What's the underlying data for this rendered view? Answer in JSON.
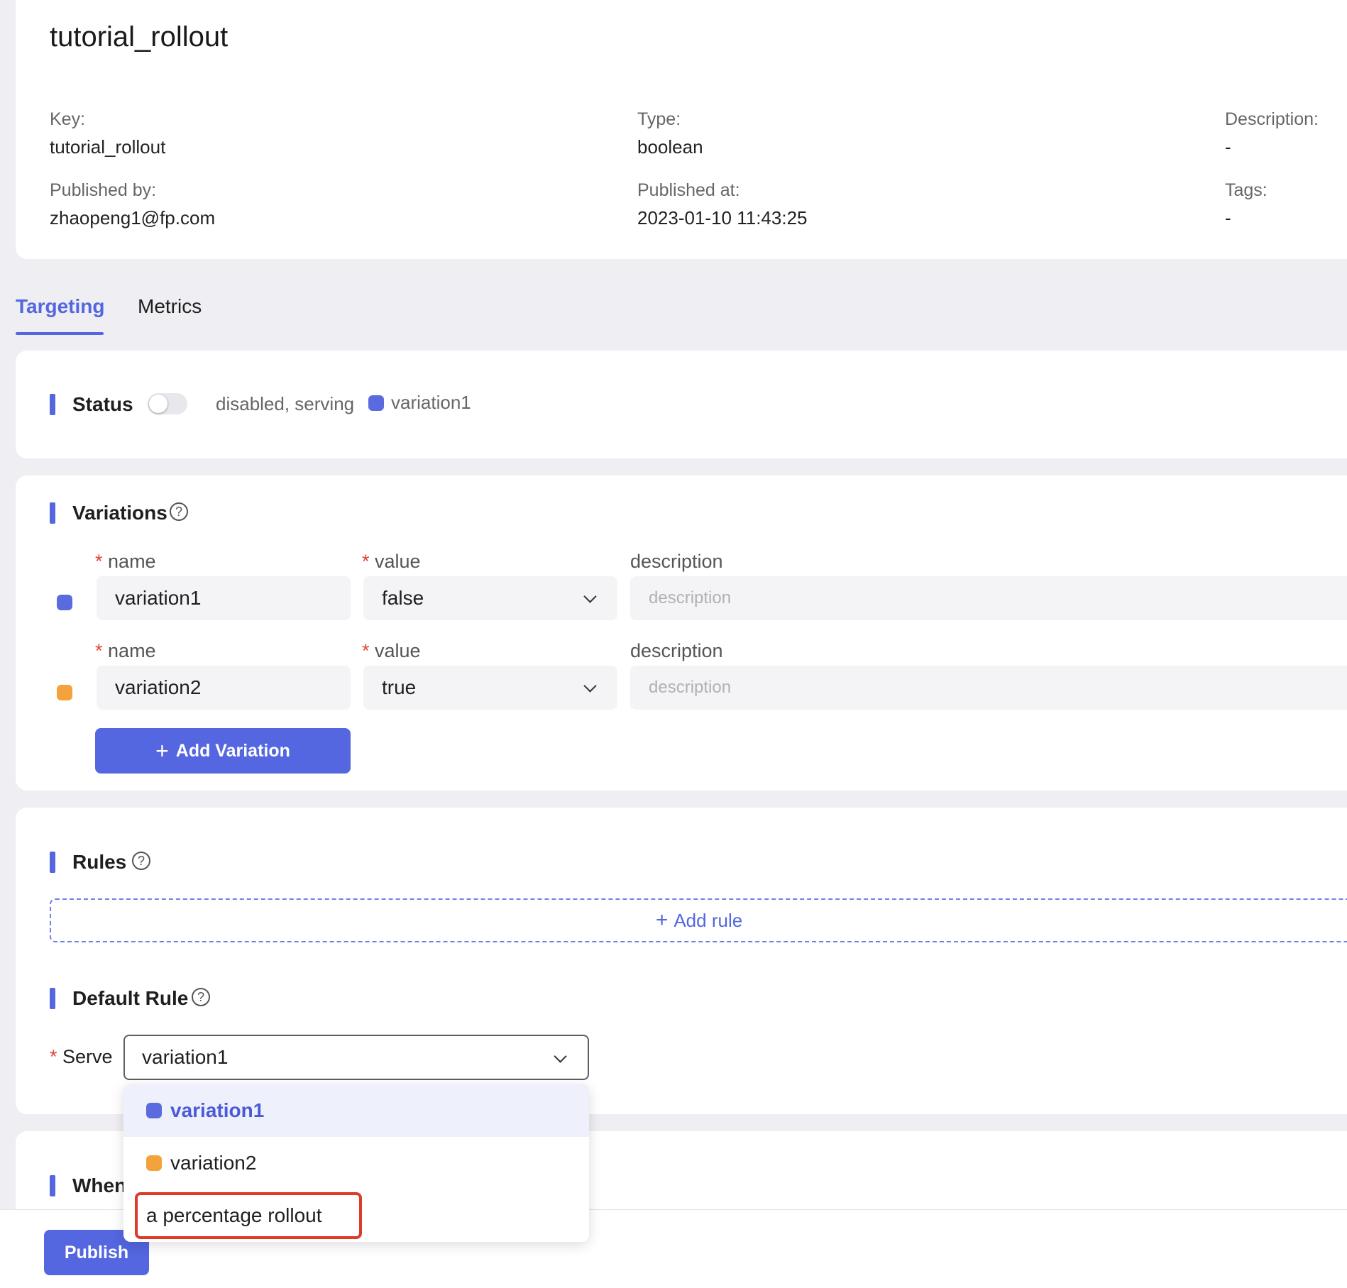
{
  "header": {
    "title": "tutorial_rollout",
    "meta": [
      {
        "label": "Key:",
        "value": "tutorial_rollout"
      },
      {
        "label": "Type:",
        "value": "boolean"
      },
      {
        "label": "Description:",
        "value": "-"
      },
      {
        "label": "Published by:",
        "value": "zhaopeng1@fp.com"
      },
      {
        "label": "Published at:",
        "value": "2023-01-10 11:43:25"
      },
      {
        "label": "Tags:",
        "value": "-"
      }
    ]
  },
  "tabs": [
    {
      "label": "Targeting",
      "active": true
    },
    {
      "label": "Metrics",
      "active": false
    }
  ],
  "status": {
    "title": "Status",
    "enabled": false,
    "text": "disabled, serving",
    "serving": "variation1"
  },
  "variations": {
    "title": "Variations",
    "help": "?",
    "labels": {
      "required": "*",
      "name": "name",
      "value": "value",
      "description": "description"
    },
    "items": [
      {
        "name": "variation1",
        "value": "false",
        "description_placeholder": "description",
        "color": "#5a6be0"
      },
      {
        "name": "variation2",
        "value": "true",
        "description_placeholder": "description",
        "color": "#f4a23c"
      }
    ],
    "add_label": "Add Variation",
    "add_icon": "+"
  },
  "rules": {
    "title": "Rules",
    "help": "?",
    "add_label": "Add rule",
    "add_icon": "+"
  },
  "default_rule": {
    "title": "Default Rule",
    "help": "?",
    "required": "*",
    "serve_label": "Serve",
    "selected": "variation1",
    "options": [
      {
        "label": "variation1",
        "color": "#5a6be0",
        "selected": true
      },
      {
        "label": "variation2",
        "color": "#f4a23c",
        "selected": false
      },
      {
        "label": "a percentage rollout",
        "selected": false
      }
    ]
  },
  "when_section": {
    "title": "When"
  },
  "footer": {
    "publish_label": "Publish"
  },
  "colors": {
    "accent": "#5466e0",
    "variation1": "#5a6be0",
    "variation2": "#f4a23c",
    "highlight": "#dd3a2a"
  }
}
